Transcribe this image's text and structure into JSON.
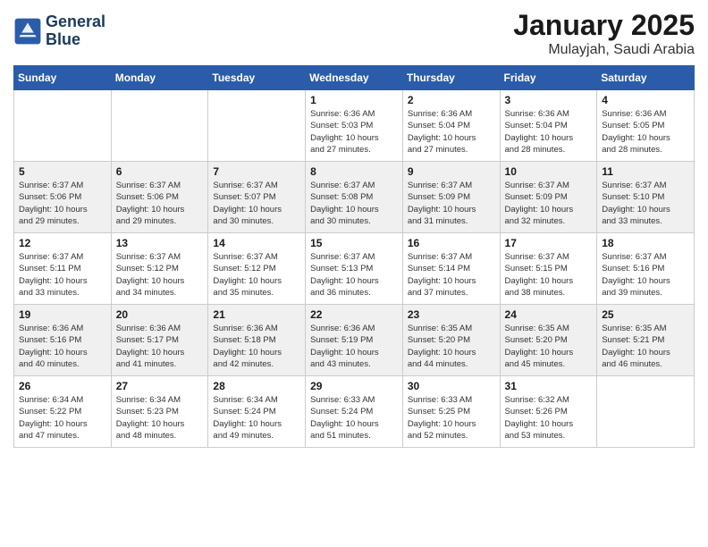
{
  "header": {
    "logo_line1": "General",
    "logo_line2": "Blue",
    "month": "January 2025",
    "location": "Mulayjah, Saudi Arabia"
  },
  "weekdays": [
    "Sunday",
    "Monday",
    "Tuesday",
    "Wednesday",
    "Thursday",
    "Friday",
    "Saturday"
  ],
  "rows": [
    {
      "cells": [
        {
          "day": "",
          "info": ""
        },
        {
          "day": "",
          "info": ""
        },
        {
          "day": "",
          "info": ""
        },
        {
          "day": "1",
          "info": "Sunrise: 6:36 AM\nSunset: 5:03 PM\nDaylight: 10 hours\nand 27 minutes."
        },
        {
          "day": "2",
          "info": "Sunrise: 6:36 AM\nSunset: 5:04 PM\nDaylight: 10 hours\nand 27 minutes."
        },
        {
          "day": "3",
          "info": "Sunrise: 6:36 AM\nSunset: 5:04 PM\nDaylight: 10 hours\nand 28 minutes."
        },
        {
          "day": "4",
          "info": "Sunrise: 6:36 AM\nSunset: 5:05 PM\nDaylight: 10 hours\nand 28 minutes."
        }
      ]
    },
    {
      "cells": [
        {
          "day": "5",
          "info": "Sunrise: 6:37 AM\nSunset: 5:06 PM\nDaylight: 10 hours\nand 29 minutes."
        },
        {
          "day": "6",
          "info": "Sunrise: 6:37 AM\nSunset: 5:06 PM\nDaylight: 10 hours\nand 29 minutes."
        },
        {
          "day": "7",
          "info": "Sunrise: 6:37 AM\nSunset: 5:07 PM\nDaylight: 10 hours\nand 30 minutes."
        },
        {
          "day": "8",
          "info": "Sunrise: 6:37 AM\nSunset: 5:08 PM\nDaylight: 10 hours\nand 30 minutes."
        },
        {
          "day": "9",
          "info": "Sunrise: 6:37 AM\nSunset: 5:09 PM\nDaylight: 10 hours\nand 31 minutes."
        },
        {
          "day": "10",
          "info": "Sunrise: 6:37 AM\nSunset: 5:09 PM\nDaylight: 10 hours\nand 32 minutes."
        },
        {
          "day": "11",
          "info": "Sunrise: 6:37 AM\nSunset: 5:10 PM\nDaylight: 10 hours\nand 33 minutes."
        }
      ]
    },
    {
      "cells": [
        {
          "day": "12",
          "info": "Sunrise: 6:37 AM\nSunset: 5:11 PM\nDaylight: 10 hours\nand 33 minutes."
        },
        {
          "day": "13",
          "info": "Sunrise: 6:37 AM\nSunset: 5:12 PM\nDaylight: 10 hours\nand 34 minutes."
        },
        {
          "day": "14",
          "info": "Sunrise: 6:37 AM\nSunset: 5:12 PM\nDaylight: 10 hours\nand 35 minutes."
        },
        {
          "day": "15",
          "info": "Sunrise: 6:37 AM\nSunset: 5:13 PM\nDaylight: 10 hours\nand 36 minutes."
        },
        {
          "day": "16",
          "info": "Sunrise: 6:37 AM\nSunset: 5:14 PM\nDaylight: 10 hours\nand 37 minutes."
        },
        {
          "day": "17",
          "info": "Sunrise: 6:37 AM\nSunset: 5:15 PM\nDaylight: 10 hours\nand 38 minutes."
        },
        {
          "day": "18",
          "info": "Sunrise: 6:37 AM\nSunset: 5:16 PM\nDaylight: 10 hours\nand 39 minutes."
        }
      ]
    },
    {
      "cells": [
        {
          "day": "19",
          "info": "Sunrise: 6:36 AM\nSunset: 5:16 PM\nDaylight: 10 hours\nand 40 minutes."
        },
        {
          "day": "20",
          "info": "Sunrise: 6:36 AM\nSunset: 5:17 PM\nDaylight: 10 hours\nand 41 minutes."
        },
        {
          "day": "21",
          "info": "Sunrise: 6:36 AM\nSunset: 5:18 PM\nDaylight: 10 hours\nand 42 minutes."
        },
        {
          "day": "22",
          "info": "Sunrise: 6:36 AM\nSunset: 5:19 PM\nDaylight: 10 hours\nand 43 minutes."
        },
        {
          "day": "23",
          "info": "Sunrise: 6:35 AM\nSunset: 5:20 PM\nDaylight: 10 hours\nand 44 minutes."
        },
        {
          "day": "24",
          "info": "Sunrise: 6:35 AM\nSunset: 5:20 PM\nDaylight: 10 hours\nand 45 minutes."
        },
        {
          "day": "25",
          "info": "Sunrise: 6:35 AM\nSunset: 5:21 PM\nDaylight: 10 hours\nand 46 minutes."
        }
      ]
    },
    {
      "cells": [
        {
          "day": "26",
          "info": "Sunrise: 6:34 AM\nSunset: 5:22 PM\nDaylight: 10 hours\nand 47 minutes."
        },
        {
          "day": "27",
          "info": "Sunrise: 6:34 AM\nSunset: 5:23 PM\nDaylight: 10 hours\nand 48 minutes."
        },
        {
          "day": "28",
          "info": "Sunrise: 6:34 AM\nSunset: 5:24 PM\nDaylight: 10 hours\nand 49 minutes."
        },
        {
          "day": "29",
          "info": "Sunrise: 6:33 AM\nSunset: 5:24 PM\nDaylight: 10 hours\nand 51 minutes."
        },
        {
          "day": "30",
          "info": "Sunrise: 6:33 AM\nSunset: 5:25 PM\nDaylight: 10 hours\nand 52 minutes."
        },
        {
          "day": "31",
          "info": "Sunrise: 6:32 AM\nSunset: 5:26 PM\nDaylight: 10 hours\nand 53 minutes."
        },
        {
          "day": "",
          "info": ""
        }
      ]
    }
  ]
}
